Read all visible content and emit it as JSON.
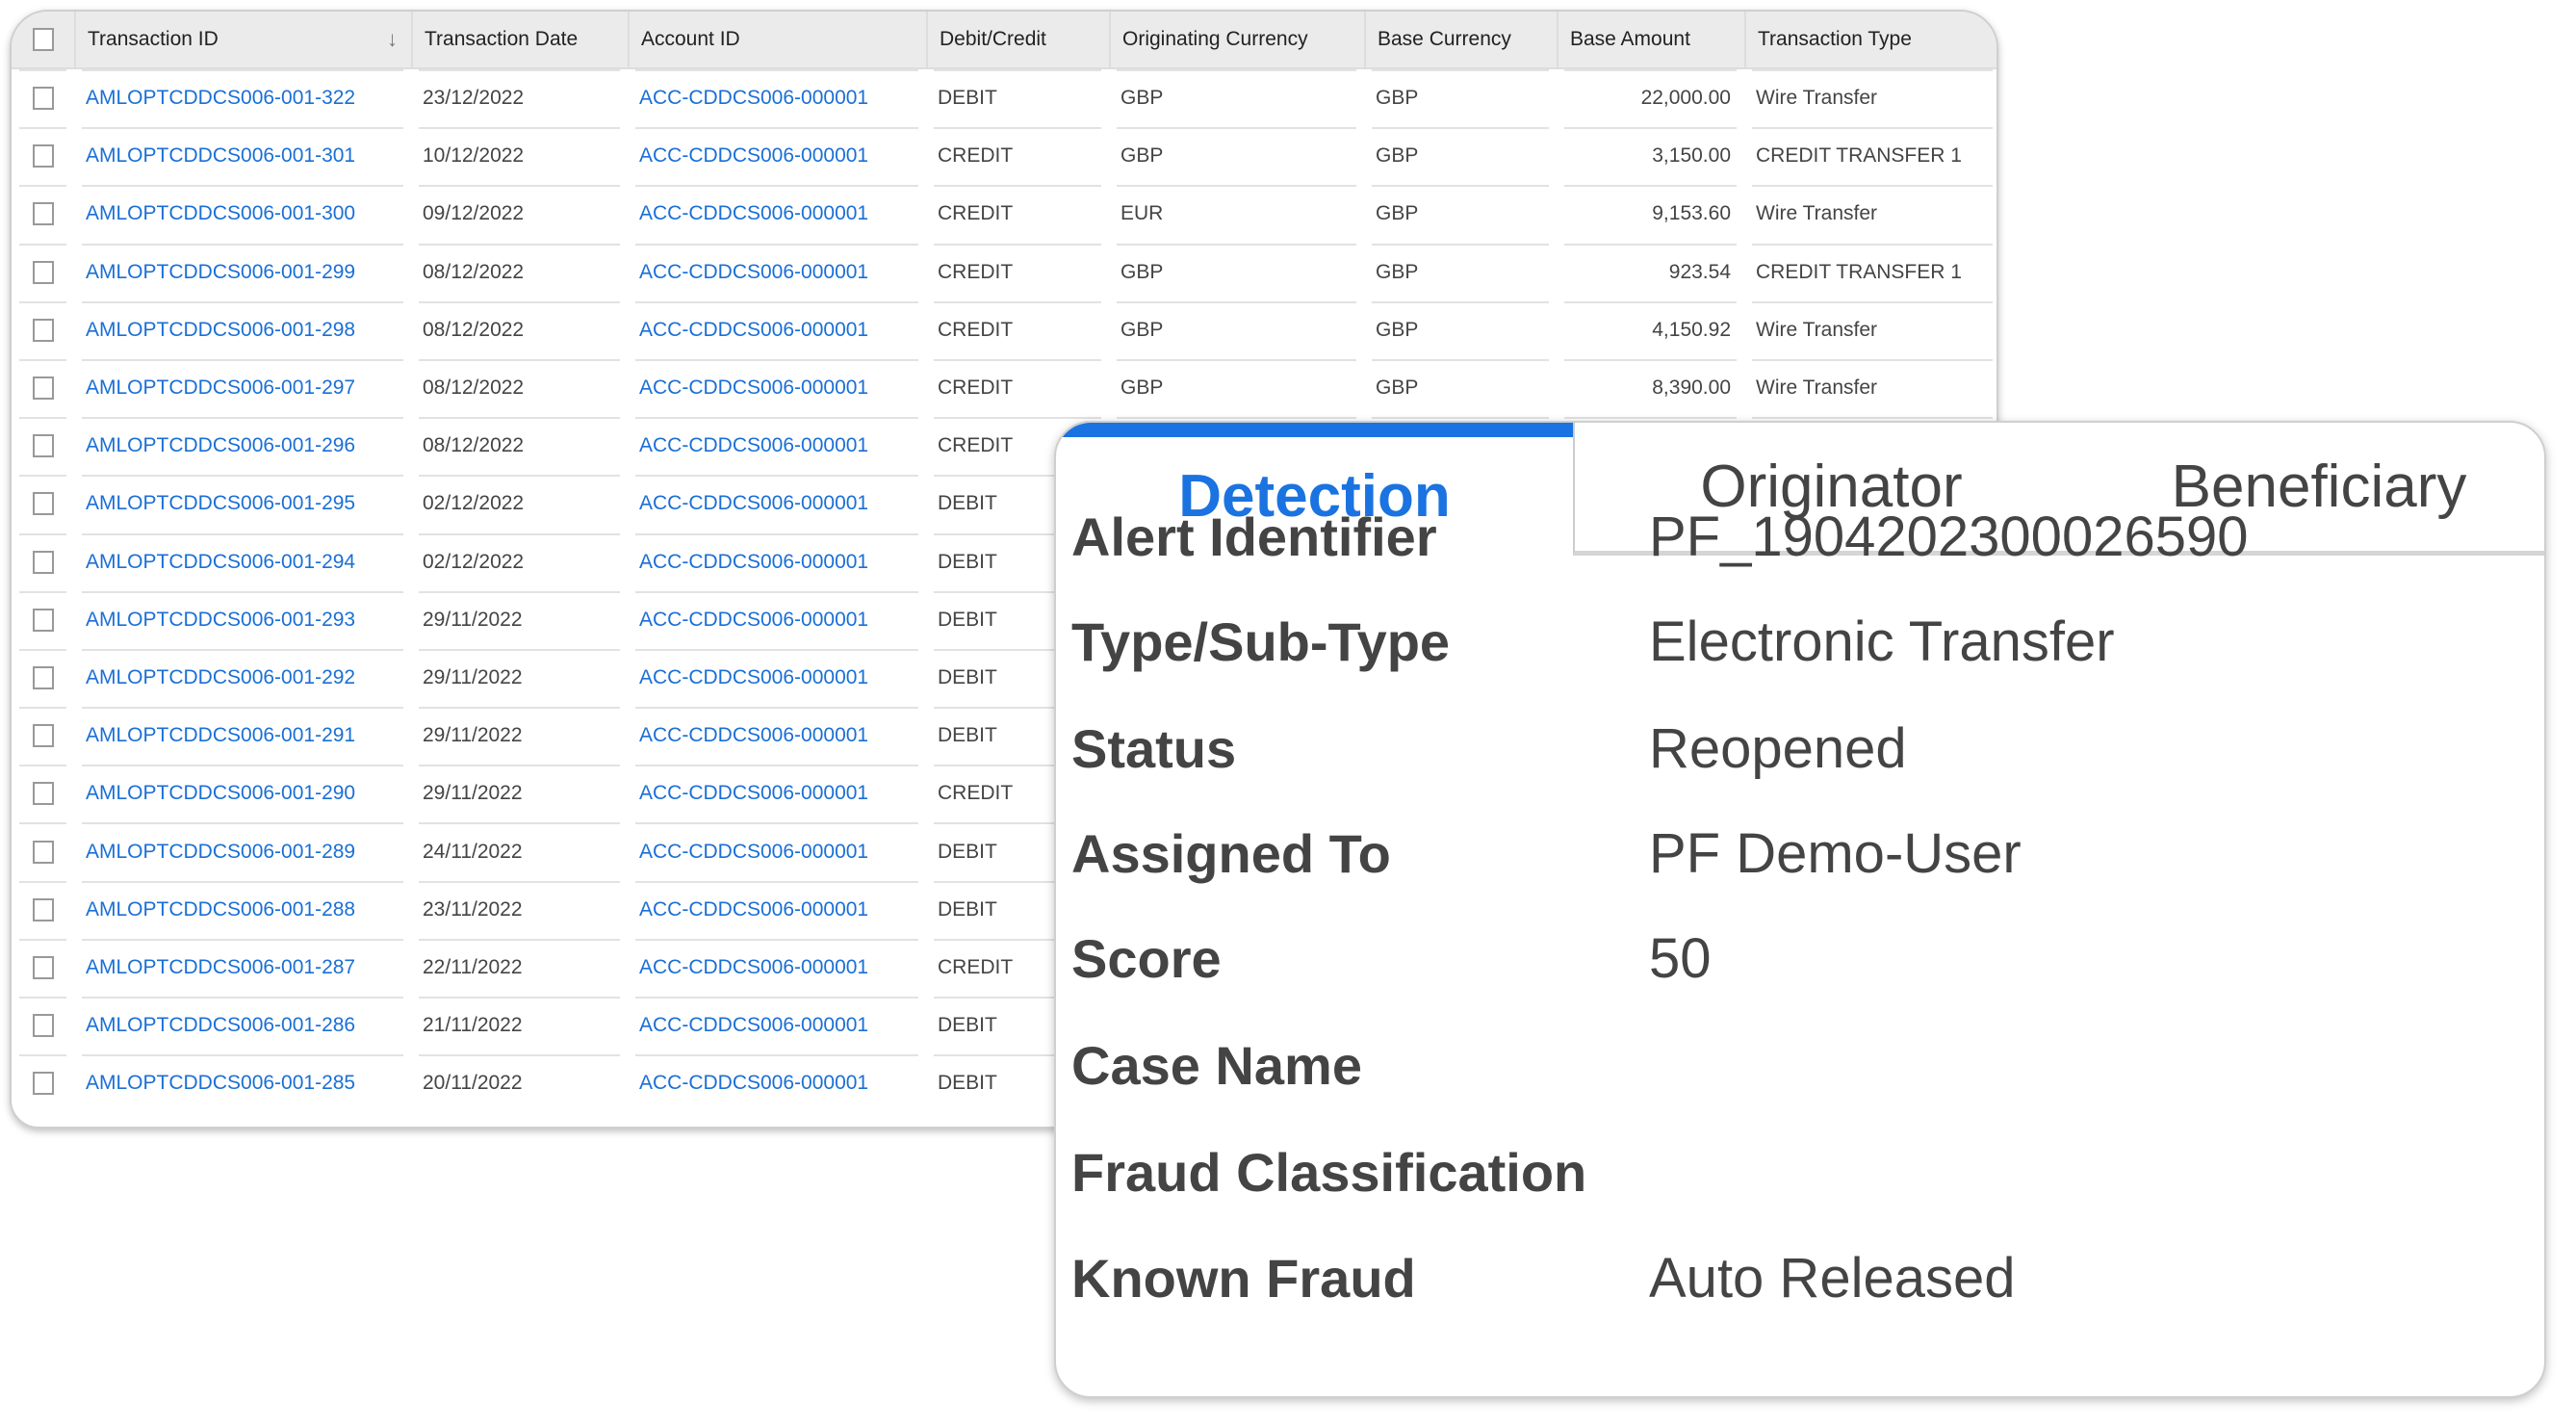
{
  "table": {
    "headers": [
      "Transaction ID",
      "Transaction Date",
      "Account ID",
      "Debit/Credit",
      "Originating Currency",
      "Base Currency",
      "Base Amount",
      "Transaction Type"
    ],
    "sort_icon": "sort-descending-icon",
    "rows": [
      {
        "id": "AMLOPTCDDCS006-001-322",
        "date": "23/12/2022",
        "account": "ACC-CDDCS006-000001",
        "dc": "DEBIT",
        "orig": "GBP",
        "base": "GBP",
        "amount": "22,000.00",
        "type": "Wire Transfer"
      },
      {
        "id": "AMLOPTCDDCS006-001-301",
        "date": "10/12/2022",
        "account": "ACC-CDDCS006-000001",
        "dc": "CREDIT",
        "orig": "GBP",
        "base": "GBP",
        "amount": "3,150.00",
        "type": "CREDIT TRANSFER 1"
      },
      {
        "id": "AMLOPTCDDCS006-001-300",
        "date": "09/12/2022",
        "account": "ACC-CDDCS006-000001",
        "dc": "CREDIT",
        "orig": "EUR",
        "base": "GBP",
        "amount": "9,153.60",
        "type": "Wire Transfer"
      },
      {
        "id": "AMLOPTCDDCS006-001-299",
        "date": "08/12/2022",
        "account": "ACC-CDDCS006-000001",
        "dc": "CREDIT",
        "orig": "GBP",
        "base": "GBP",
        "amount": "923.54",
        "type": "CREDIT TRANSFER 1"
      },
      {
        "id": "AMLOPTCDDCS006-001-298",
        "date": "08/12/2022",
        "account": "ACC-CDDCS006-000001",
        "dc": "CREDIT",
        "orig": "GBP",
        "base": "GBP",
        "amount": "4,150.92",
        "type": "Wire Transfer"
      },
      {
        "id": "AMLOPTCDDCS006-001-297",
        "date": "08/12/2022",
        "account": "ACC-CDDCS006-000001",
        "dc": "CREDIT",
        "orig": "GBP",
        "base": "GBP",
        "amount": "8,390.00",
        "type": "Wire Transfer"
      },
      {
        "id": "AMLOPTCDDCS006-001-296",
        "date": "08/12/2022",
        "account": "ACC-CDDCS006-000001",
        "dc": "CREDIT"
      },
      {
        "id": "AMLOPTCDDCS006-001-295",
        "date": "02/12/2022",
        "account": "ACC-CDDCS006-000001",
        "dc": "DEBIT"
      },
      {
        "id": "AMLOPTCDDCS006-001-294",
        "date": "02/12/2022",
        "account": "ACC-CDDCS006-000001",
        "dc": "DEBIT"
      },
      {
        "id": "AMLOPTCDDCS006-001-293",
        "date": "29/11/2022",
        "account": "ACC-CDDCS006-000001",
        "dc": "DEBIT"
      },
      {
        "id": "AMLOPTCDDCS006-001-292",
        "date": "29/11/2022",
        "account": "ACC-CDDCS006-000001",
        "dc": "DEBIT"
      },
      {
        "id": "AMLOPTCDDCS006-001-291",
        "date": "29/11/2022",
        "account": "ACC-CDDCS006-000001",
        "dc": "DEBIT"
      },
      {
        "id": "AMLOPTCDDCS006-001-290",
        "date": "29/11/2022",
        "account": "ACC-CDDCS006-000001",
        "dc": "CREDIT"
      },
      {
        "id": "AMLOPTCDDCS006-001-289",
        "date": "24/11/2022",
        "account": "ACC-CDDCS006-000001",
        "dc": "DEBIT"
      },
      {
        "id": "AMLOPTCDDCS006-001-288",
        "date": "23/11/2022",
        "account": "ACC-CDDCS006-000001",
        "dc": "DEBIT"
      },
      {
        "id": "AMLOPTCDDCS006-001-287",
        "date": "22/11/2022",
        "account": "ACC-CDDCS006-000001",
        "dc": "CREDIT"
      },
      {
        "id": "AMLOPTCDDCS006-001-286",
        "date": "21/11/2022",
        "account": "ACC-CDDCS006-000001",
        "dc": "DEBIT"
      },
      {
        "id": "AMLOPTCDDCS006-001-285",
        "date": "20/11/2022",
        "account": "ACC-CDDCS006-000001",
        "dc": "DEBIT"
      }
    ]
  },
  "detail": {
    "tabs": [
      "Detection",
      "Originator",
      "Beneficiary"
    ],
    "active_tab": "Detection",
    "fields": [
      {
        "label": "Alert Identifier",
        "value": "PF_1904202300026590"
      },
      {
        "label": "Type/Sub-Type",
        "value": "Electronic Transfer"
      },
      {
        "label": "Status",
        "value": "Reopened"
      },
      {
        "label": "Assigned To",
        "value": "PF Demo-User"
      },
      {
        "label": "Score",
        "value": "50"
      },
      {
        "label": "Case Name",
        "value": ""
      },
      {
        "label": "Fraud Classification",
        "value": ""
      },
      {
        "label": "Known Fraud",
        "value": "Auto Released"
      }
    ]
  },
  "colors": {
    "link": "#1a6fd6",
    "accent": "#1a73e0",
    "header_bg": "#ebebeb"
  }
}
